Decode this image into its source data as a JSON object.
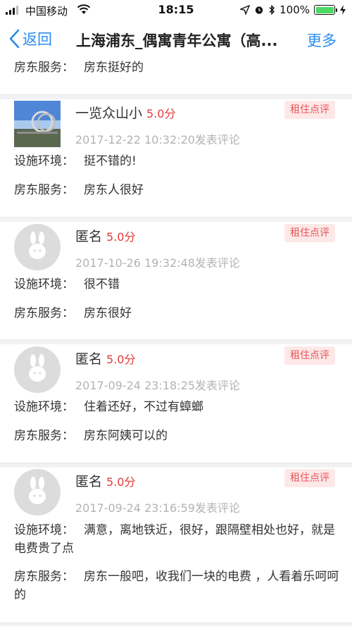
{
  "status_bar": {
    "carrier": "中国移动",
    "time": "18:15",
    "battery": "100%",
    "battery_level": 1.0
  },
  "nav": {
    "back_label": "返回",
    "title": "上海浦东_偶寓青年公寓（高...",
    "more_label": "更多"
  },
  "labels": {
    "facilities": "设施环境：",
    "landlord": "房东服务："
  },
  "top_partial": {
    "landlord_value": "房东挺好的"
  },
  "reviews": [
    {
      "name": "一览众山小",
      "score": "5.0分",
      "badge": "租住点评",
      "time": "2017-12-22 10:32:20发表评论",
      "facilities": "挺不错的!",
      "landlord": "房东人很好",
      "avatar": "photo"
    },
    {
      "name": "匿名",
      "score": "5.0分",
      "badge": "租住点评",
      "time": "2017-10-26 19:32:48发表评论",
      "facilities": "很不错",
      "landlord": "房东很好",
      "avatar": "default"
    },
    {
      "name": "匿名",
      "score": "5.0分",
      "badge": "租住点评",
      "time": "2017-09-24 23:18:25发表评论",
      "facilities": "住着还好，不过有蟑螂",
      "landlord": "房东阿姨可以的",
      "avatar": "default"
    },
    {
      "name": "匿名",
      "score": "5.0分",
      "badge": "租住点评",
      "time": "2017-09-24 23:16:59发表评论",
      "facilities": "满意，离地铁近，很好，跟隔壁相处也好，就是电费贵了点",
      "landlord": "房东一般吧，收我们一块的电费 ，人看着乐呵呵的",
      "avatar": "default"
    }
  ],
  "colors": {
    "accent": "#2a8cf0",
    "score": "#e23a3a",
    "badge_bg": "#fde8e8",
    "badge_text": "#e85555",
    "battery": "#4cd964"
  }
}
